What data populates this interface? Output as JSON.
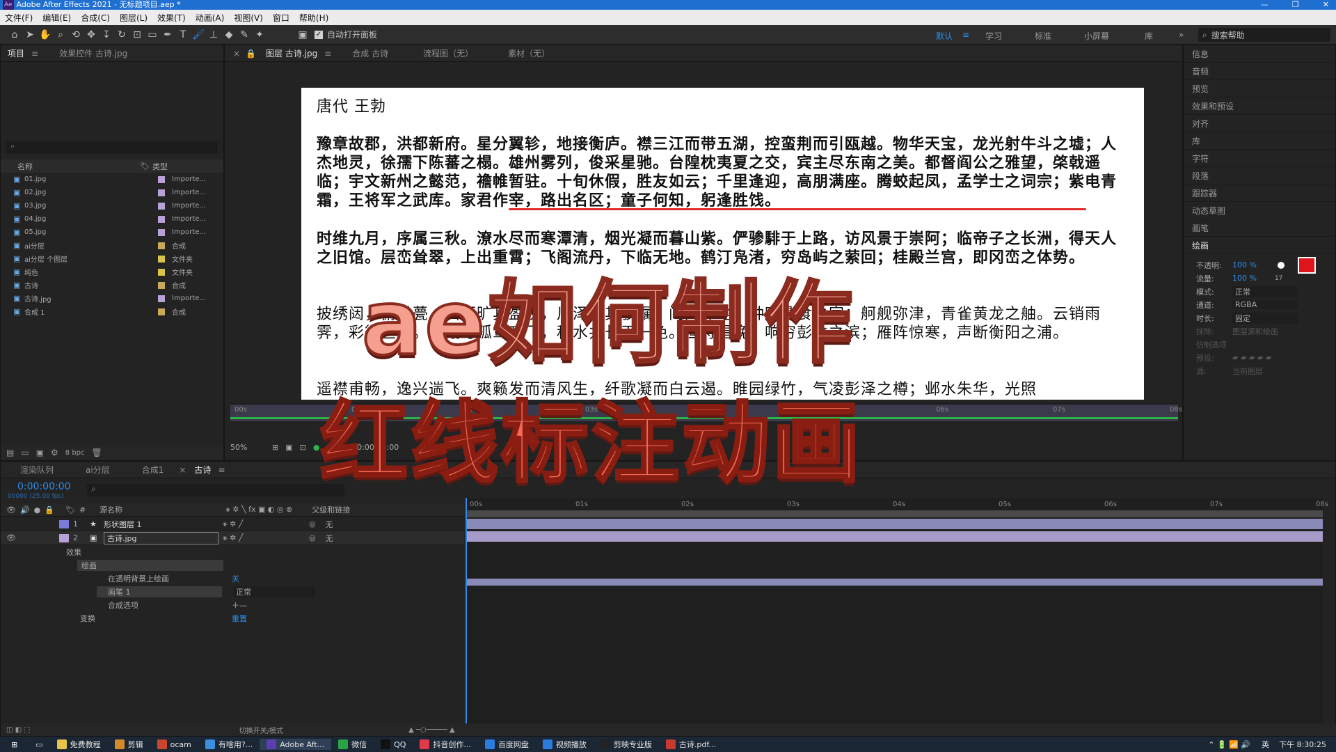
{
  "window": {
    "title": "Adobe After Effects 2021 - 无标题项目.aep *"
  },
  "menu": [
    "文件(F)",
    "编辑(E)",
    "合成(C)",
    "图层(L)",
    "效果(T)",
    "动画(A)",
    "视图(V)",
    "窗口",
    "帮助(H)"
  ],
  "toolbar": {
    "auto_open": "自动打开面板",
    "workspaces": [
      "默认",
      "学习",
      "标准",
      "小屏幕",
      "库"
    ],
    "search_placeholder": "搜索帮助"
  },
  "project": {
    "tab": "项目",
    "effects_tab": "效果控件 古诗.jpg",
    "col_name": "名称",
    "col_type": "类型",
    "items": [
      {
        "name": "01.jpg",
        "type": "Importe...",
        "color": "#b7a1d6"
      },
      {
        "name": "02.jpg",
        "type": "Importe...",
        "color": "#b7a1d6"
      },
      {
        "name": "03.jpg",
        "type": "Importe...",
        "color": "#b7a1d6"
      },
      {
        "name": "04.jpg",
        "type": "Importe...",
        "color": "#b7a1d6"
      },
      {
        "name": "05.jpg",
        "type": "Importe...",
        "color": "#b7a1d6"
      },
      {
        "name": "ai分层",
        "type": "合成",
        "color": "#c9a85a"
      },
      {
        "name": "ai分层 个图层",
        "type": "文件夹",
        "color": "#d8c24a"
      },
      {
        "name": "纯色",
        "type": "文件夹",
        "color": "#d8c24a"
      },
      {
        "name": "古诗",
        "type": "合成",
        "color": "#c9a85a"
      },
      {
        "name": "古诗.jpg",
        "type": "Importe...",
        "color": "#b7a1d6"
      },
      {
        "name": "合成 1",
        "type": "合成",
        "color": "#c9a85a"
      }
    ],
    "bpc": "8 bpc"
  },
  "viewer": {
    "tabs": [
      "图层 古诗.jpg",
      "合成 古诗",
      "流程图（无）",
      "素材（无）"
    ],
    "zoom": "50%",
    "time": "0:00:00:00",
    "ruler": [
      "00s",
      "01s",
      "02s",
      "03s",
      "04s",
      "05s",
      "06s",
      "07s",
      "08s"
    ]
  },
  "doc": {
    "lines": [
      "唐代 王勃",
      "豫章故郡，洪都新府。星分翼轸，地接衡庐。襟三江而带五湖，控蛮荆而引瓯越。物华天宝，龙光射牛斗之墟；人杰地灵，徐孺下陈蕃之榻。雄州雾列，俊采星驰。台隍枕夷夏之交，宾主尽东南之美。都督阎公之雅望，棨戟遥临；宇文新州之懿范，襜帷暂驻。十旬休假，胜友如云；千里逢迎，高朋满座。腾蛟起凤，孟学士之词宗；紫电青霜，王将军之武库。家君作宰，路出名区；童子何知，躬逢胜饯。",
      "时维九月，序属三秋。潦水尽而寒潭清，烟光凝而暮山紫。俨骖騑于上路，访风景于崇阿；临帝子之长洲，得天人之旧馆。层峦耸翠，上出重霄；飞阁流丹，下临无地。鹤汀凫渚，穷岛屿之萦回；桂殿兰宫，即冈峦之体势。",
      "披绣闼，俯雕甍，山原旷其盈视，川泽纡其骇瞩。闾阎扑地，钟鸣鼎食之家；舸舰弥津，青雀黄龙之舳。云销雨霁，彩彻区明。落霞与孤鹜齐飞，秋水共长天一色。渔舟唱晚，响穷彭蠡之滨；雁阵惊寒，声断衡阳之浦。",
      "遥襟甫畅，逸兴遄飞。爽籁发而清风生，纤歌凝而白云遏。睢园绿竹，气凌彭泽之樽；邺水朱华，光照"
    ]
  },
  "overlay": {
    "line1": "ae如何制作",
    "line2": "红线标注动画"
  },
  "right_panel": {
    "items": [
      "信息",
      "音频",
      "预览",
      "效果和预设",
      "对齐",
      "库",
      "字符",
      "段落",
      "跟踪器",
      "动态草图",
      "画笔",
      "绘画"
    ],
    "paint": {
      "opacity_label": "不透明:",
      "opacity": "100 %",
      "flow_label": "流量:",
      "flow": "100 %",
      "mode_label": "模式:",
      "mode": "正常",
      "channel_label": "通道:",
      "channel": "RGBA",
      "duration_label": "时长:",
      "duration": "固定",
      "erase": "抹除:",
      "erase_val": "图层源和绘画",
      "clone_options": "仿制选项",
      "preset": "预设:",
      "source": "源:",
      "source_val": "当前图层",
      "brush_size": "17",
      "fg_color": "#e0141b",
      "bg_color": "#ffffff"
    }
  },
  "timeline": {
    "tabs": [
      "渲染队列",
      "ai分层",
      "合成1",
      "古诗"
    ],
    "time": "0:00:00:00",
    "fps": "00000 (25.00 fps)",
    "col_source": "源名称",
    "col_parent": "父级和链接",
    "layers": [
      {
        "num": "1",
        "name": "形状图层 1",
        "parent": "无",
        "color": "#7a7ad8"
      },
      {
        "num": "2",
        "name": "古诗.jpg",
        "parent": "无",
        "color": "#b7a1d6"
      }
    ],
    "props": {
      "effects": "效果",
      "paint": "绘画",
      "paint_on_transparent": "在透明背景上绘画",
      "off": "关",
      "brush": "画笔 1",
      "blend": "正常",
      "composite": "合成选项",
      "transform": "变换",
      "reset": "重置"
    },
    "footer": "切换开关/模式",
    "ruler": [
      "00s",
      "01s",
      "02s",
      "03s",
      "04s",
      "05s",
      "06s",
      "07s",
      "08s"
    ]
  },
  "taskbar": {
    "items": [
      "免费教程",
      "剪辑",
      "ocam",
      "有啥用?...",
      "Adobe Aft...",
      "微信",
      "QQ",
      "抖音创作...",
      "百度网盘",
      "视频播放",
      "剪映专业版",
      "古诗.pdf..."
    ],
    "clock": "下午 8:30:25",
    "ime": "英"
  }
}
